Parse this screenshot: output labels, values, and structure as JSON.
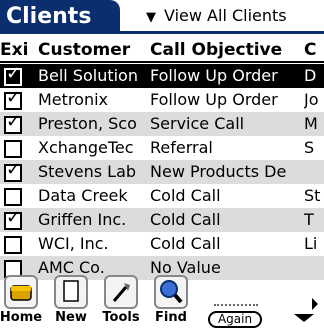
{
  "header": {
    "title": "Clients",
    "view_filter": "View All Clients"
  },
  "table": {
    "columns": [
      "Exi",
      "Customer",
      "Call Objective",
      "C"
    ],
    "rows": [
      {
        "checked": true,
        "customer": "Bell Solution",
        "objective": "Follow Up Order",
        "c": "D",
        "state": "selected"
      },
      {
        "checked": true,
        "customer": "Metronix",
        "objective": "Follow Up Order",
        "c": "Jo",
        "state": "normal"
      },
      {
        "checked": true,
        "customer": "Preston, Sco",
        "objective": "Service Call",
        "c": "M",
        "state": "alt"
      },
      {
        "checked": false,
        "customer": "XchangeTec",
        "objective": "Referral",
        "c": "S",
        "state": "normal"
      },
      {
        "checked": true,
        "customer": "Stevens Lab",
        "objective": "New Products De",
        "c": "",
        "state": "alt"
      },
      {
        "checked": false,
        "customer": "Data Creek",
        "objective": "Cold Call",
        "c": "St",
        "state": "normal"
      },
      {
        "checked": true,
        "customer": "Griffen Inc.",
        "objective": "Cold Call",
        "c": "T",
        "state": "alt"
      },
      {
        "checked": false,
        "customer": "WCI, Inc.",
        "objective": "Cold Call",
        "c": "Li",
        "state": "normal"
      },
      {
        "checked": false,
        "customer": "AMC Co.",
        "objective": "No Value",
        "c": "",
        "state": "alt"
      }
    ]
  },
  "toolbar": {
    "buttons": [
      {
        "label": "Home",
        "icon": "home-icon"
      },
      {
        "label": "New",
        "icon": "new-document-icon"
      },
      {
        "label": "Tools",
        "icon": "tools-icon"
      },
      {
        "label": "Find",
        "icon": "magnifier-icon"
      }
    ],
    "again_label": "Again"
  },
  "colors": {
    "title_bg": "#0a2e6e",
    "selected_row_bg": "#000000",
    "alt_row_bg": "#dcdcdc"
  }
}
